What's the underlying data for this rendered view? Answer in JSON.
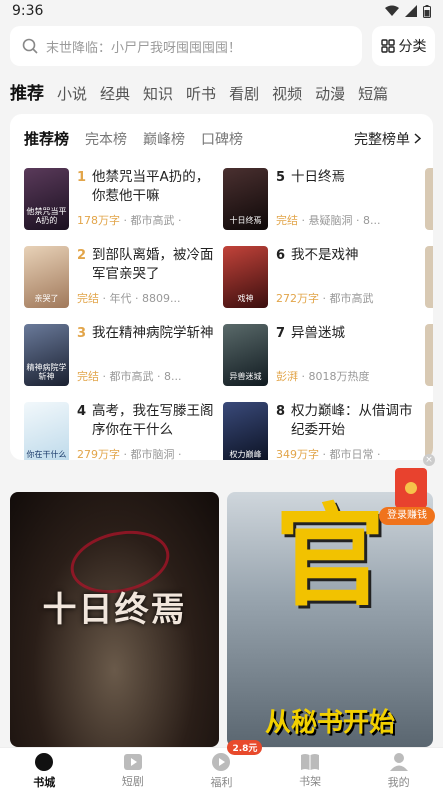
{
  "status_bar": {
    "time": "9:36"
  },
  "search": {
    "placeholder": "末世降临：小尸尸我呀囤囤囤囤！",
    "category_label": "分类"
  },
  "tabs": [
    "推荐",
    "小说",
    "经典",
    "知识",
    "听书",
    "看剧",
    "视频",
    "动漫",
    "短篇"
  ],
  "ranking": {
    "tabs": [
      "推荐榜",
      "完本榜",
      "巅峰榜",
      "口碑榜"
    ],
    "full_list_label": "完整榜单",
    "books": [
      {
        "rank": "1",
        "title": "他禁咒当平A扔的，你惹他干嘛",
        "meta_hl": "178万字",
        "meta": " · 都市高武 ·",
        "cover_text": "他禁咒当平A扔的",
        "cover_color": "#3a2a3a"
      },
      {
        "rank": "2",
        "title": "到部队离婚，被冷面军官亲哭了",
        "meta_hl": "完结",
        "meta": " · 年代 · 8809...",
        "cover_text": "亲哭了",
        "cover_color": "#c8a27e"
      },
      {
        "rank": "3",
        "title": "我在精神病院学斩神",
        "meta_hl": "完结",
        "meta": " · 都市高武 · 8...",
        "cover_text": "精神病院学斩神",
        "cover_color": "#3a4a6a"
      },
      {
        "rank": "4",
        "title": "高考，我在写滕王阁序你在干什么",
        "meta_hl": "279万字",
        "meta": " · 都市脑洞 ·",
        "cover_text": "你在干什么",
        "cover_color": "#dfeef6"
      },
      {
        "rank": "5",
        "title": "十日终焉",
        "meta_hl": "完结",
        "meta": " · 悬疑脑洞 · 8...",
        "cover_text": "十日终焉",
        "cover_color": "#2a1a1a"
      },
      {
        "rank": "6",
        "title": "我不是戏神",
        "meta_hl": "272万字",
        "meta": " · 都市高武",
        "cover_text": "戏神",
        "cover_color": "#7a1a1a"
      },
      {
        "rank": "7",
        "title": "异兽迷城",
        "meta_hl": "彭湃",
        "meta": " · 8018万热度",
        "cover_text": "异兽迷城",
        "cover_color": "#2a3a4a"
      },
      {
        "rank": "8",
        "title": "权力巅峰：从借调市纪委开始",
        "meta_hl": "349万字",
        "meta": " · 都市日常 ·",
        "cover_text": "权力巅峰",
        "cover_color": "#1a2a4a"
      }
    ]
  },
  "banners": {
    "left_title": "十日终焉",
    "right_big": "官",
    "right_sub": "从秘书开始"
  },
  "promo": {
    "login_earn": "登录赚钱"
  },
  "bottom_nav": {
    "items": [
      "书城",
      "短剧",
      "福利",
      "书架",
      "我的"
    ],
    "welfare_badge": "2.8元"
  },
  "colors": {
    "accent_orange": "#e2a54a",
    "promo_red": "#e8422e"
  }
}
